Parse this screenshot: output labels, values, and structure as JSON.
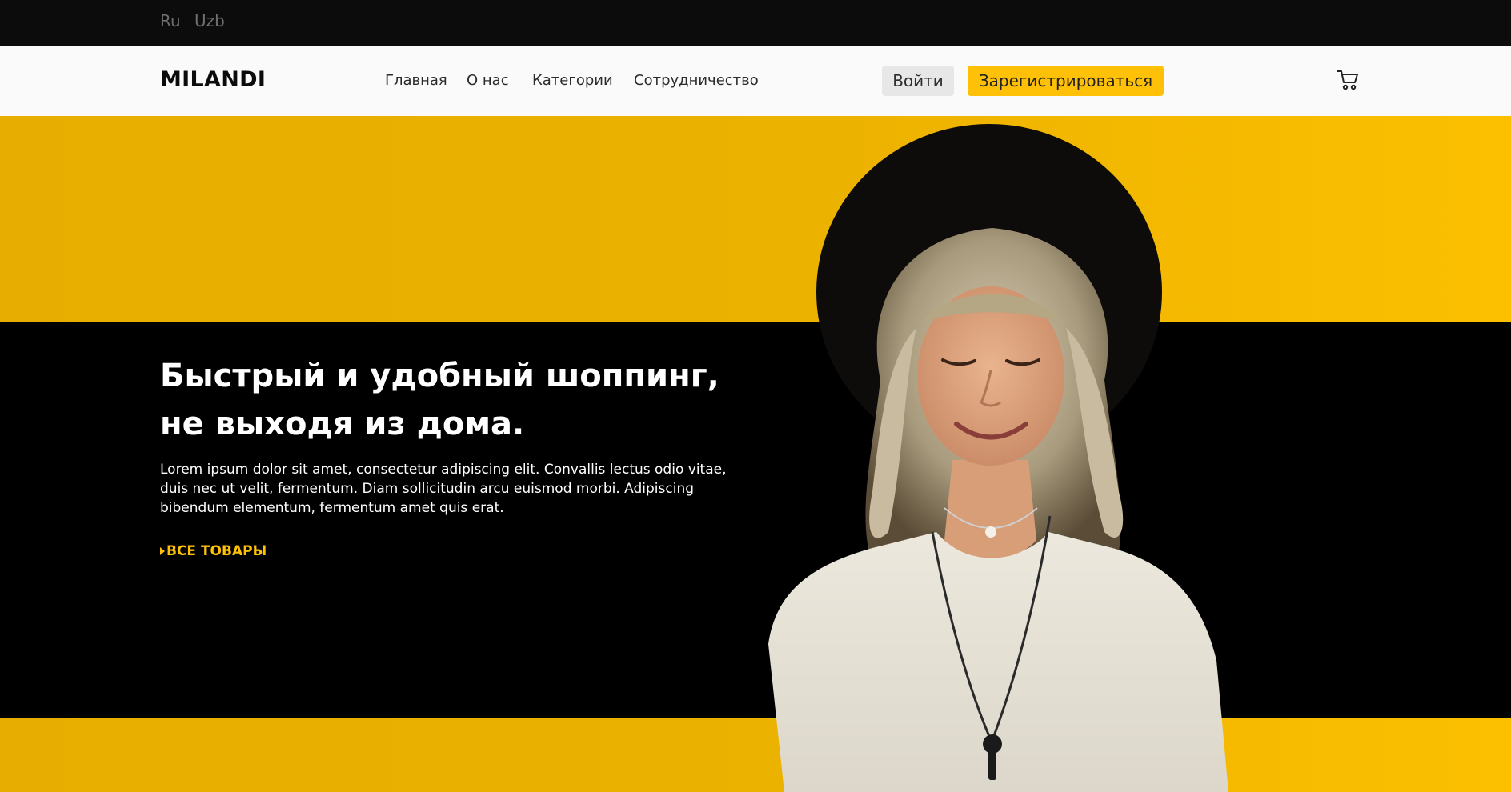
{
  "lang": {
    "ru": "Ru",
    "uz": "Uzb"
  },
  "header": {
    "logo": "MILANDI",
    "nav": [
      "Главная",
      "О нас",
      "Категории",
      "Сотрудничество"
    ],
    "login": "Войти",
    "register": "Зарегистрироваться",
    "cart_icon": "cart-icon"
  },
  "hero": {
    "title_line1": "Быстрый и удобный шоппинг,",
    "title_line2": "не выходя из дома.",
    "text": "Lorem ipsum dolor sit amet, consectetur adipiscing elit. Convallis lectus odio vitae, duis nec ut velit, fermentum. Diam sollicitudin arcu euismod morbi. Adipiscing bibendum elementum, fermentum amet quis erat.",
    "cta": "ВСЕ ТОВАРЫ",
    "colors": {
      "accent": "#ffc107",
      "band": "#ecb200",
      "dark": "#000000"
    }
  }
}
